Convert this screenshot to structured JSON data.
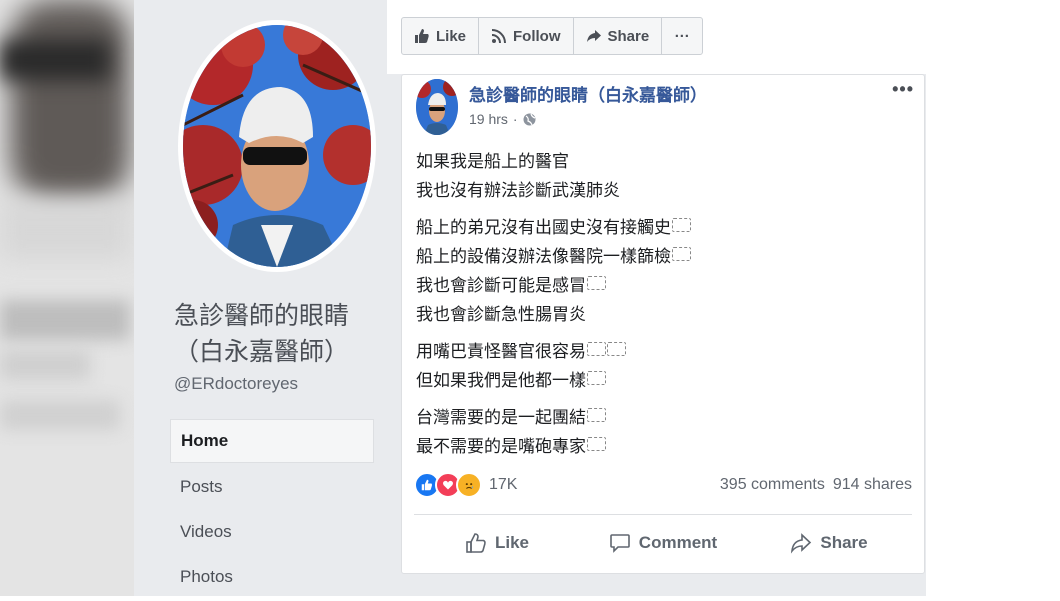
{
  "page": {
    "name": "急診醫師的眼睛（白永嘉醫師）",
    "handle": "@ERdoctoreyes"
  },
  "nav": {
    "items": [
      {
        "label": "Home",
        "active": true
      },
      {
        "label": "Posts",
        "active": false
      },
      {
        "label": "Videos",
        "active": false
      },
      {
        "label": "Photos",
        "active": false
      }
    ]
  },
  "action_bar": {
    "like_label": "Like",
    "follow_label": "Follow",
    "share_label": "Share",
    "more_label": "···"
  },
  "post": {
    "author": "急診醫師的眼睛（白永嘉醫師）",
    "time": "19 hrs",
    "more_label": "•••",
    "paragraphs": [
      [
        "如果我是船上的醫官",
        "我也沒有辦法診斷武漢肺炎"
      ],
      [
        "船上的弟兄沒有出國史沒有接觸史",
        "船上的設備沒辦法像醫院一樣篩檢",
        "我也會診斷可能是感冒",
        "我也會診斷急性腸胃炎"
      ],
      [
        "用嘴巴責怪醫官很容易",
        "但如果我們是他都一樣"
      ],
      [
        "台灣需要的是一起團結",
        "最不需要的是嘴砲專家"
      ]
    ],
    "reaction_count": "17K",
    "comments": "395 comments",
    "shares": "914 shares",
    "actions": {
      "like": "Like",
      "comment": "Comment",
      "share": "Share"
    }
  },
  "colors": {
    "link_blue": "#365899",
    "like_blue": "#1877f2",
    "love_red": "#f33e58",
    "sad_yellow": "#f7b125"
  }
}
